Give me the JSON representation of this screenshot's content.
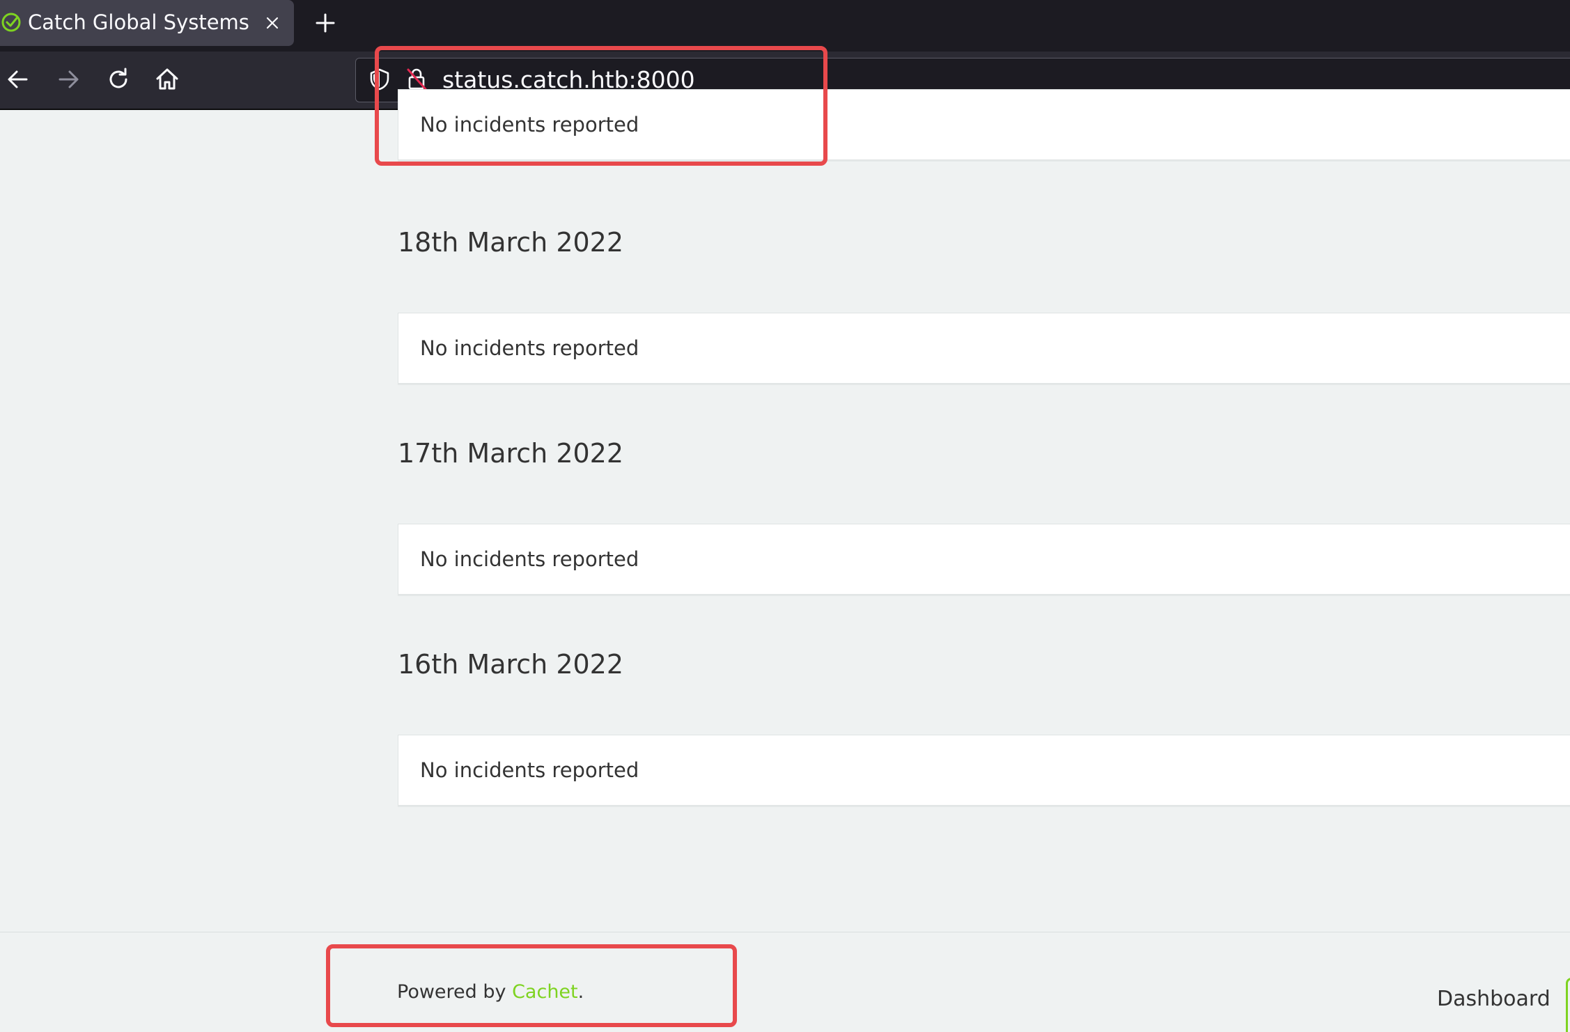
{
  "browser": {
    "tab_title": "Catch Global Systems",
    "url": "status.catch.htb:8000",
    "icons": [
      "check-circle-icon",
      "close-icon",
      "plus-icon",
      "back-arrow-icon",
      "forward-arrow-icon",
      "reload-icon",
      "home-icon",
      "shield-icon",
      "insecure-lock-icon"
    ]
  },
  "timeline": {
    "top_panel_text": "No incidents reported",
    "days": [
      {
        "date": "18th March 2022",
        "message": "No incidents reported"
      },
      {
        "date": "17th March 2022",
        "message": "No incidents reported"
      },
      {
        "date": "16th March 2022",
        "message": "No incidents reported"
      }
    ]
  },
  "footer": {
    "powered_prefix": "Powered by ",
    "powered_link": "Cachet",
    "powered_suffix": ".",
    "dashboard_label": "Dashboard"
  },
  "colors": {
    "accent_green": "#7ed321",
    "annotation_red": "#e8494c",
    "page_background": "#eff2f2"
  }
}
